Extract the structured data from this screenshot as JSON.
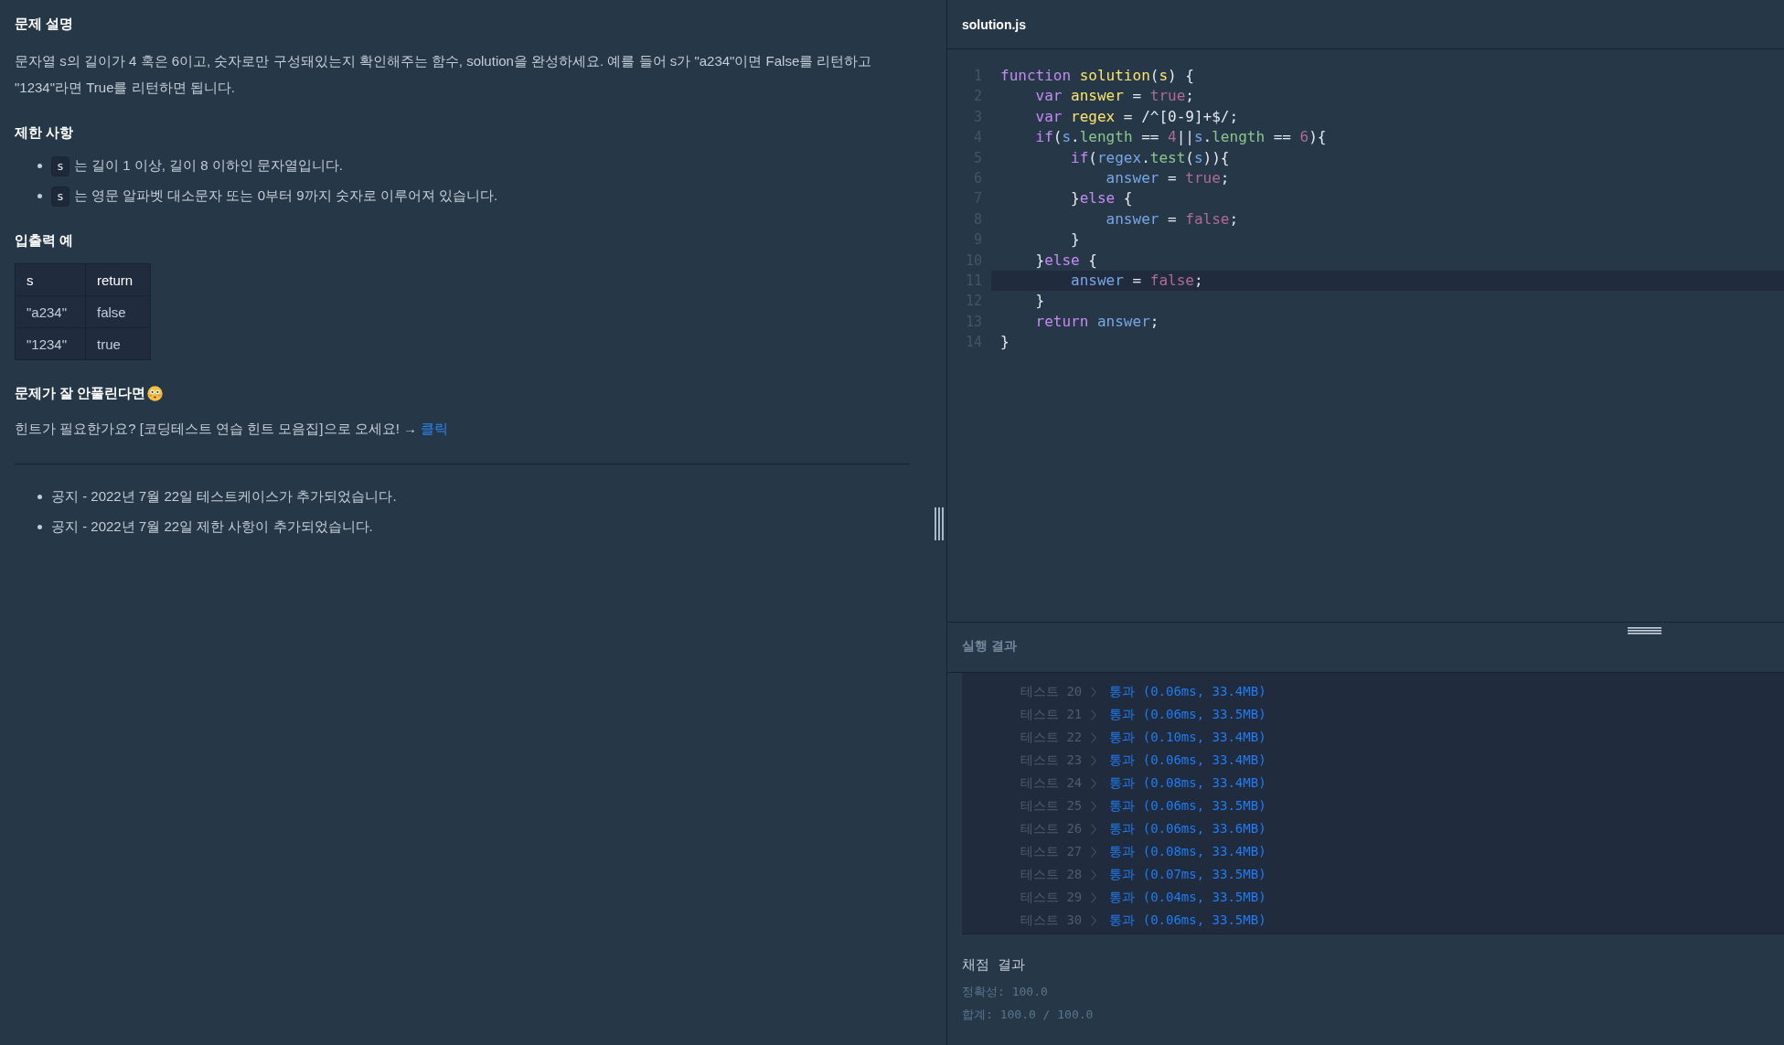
{
  "problem": {
    "title": "문제 설명",
    "description": "문자열 s의 길이가 4 혹은 6이고, 숫자로만 구성돼있는지 확인해주는 함수, solution을 완성하세요. 예를 들어 s가 \"a234\"이면 False를 리턴하고 \"1234\"라면 True를 리턴하면 됩니다.",
    "constraints_title": "제한 사항",
    "constraints": [
      {
        "code": "s",
        "text": "는 길이 1 이상, 길이 8 이하인 문자열입니다."
      },
      {
        "code": "s",
        "text": "는 영문 알파벳 대소문자 또는 0부터 9까지 숫자로 이루어져 있습니다."
      }
    ],
    "examples_title": "입출력 예",
    "examples": {
      "columns": [
        "s",
        "return"
      ],
      "rows": [
        [
          "\"a234\"",
          "false"
        ],
        [
          "\"1234\"",
          "true"
        ]
      ]
    },
    "hint_title": "문제가 잘 안풀린다면",
    "hint": {
      "text": "힌트가 필요한가요? [코딩테스트 연습 힌트 모음집]으로 오세요! →",
      "link": "클릭"
    },
    "notices": [
      "공지 - 2022년 7월 22일 테스트케이스가 추가되었습니다.",
      "공지 - 2022년 7월 22일 제한 사항이 추가되었습니다."
    ]
  },
  "editor": {
    "filename": "solution.js",
    "lines": [
      {
        "number": "1",
        "current": false,
        "tokens": [
          {
            "kind": "keyword",
            "text": "function "
          },
          {
            "kind": "definition",
            "text": "solution"
          },
          {
            "kind": "plain",
            "text": "("
          },
          {
            "kind": "definition",
            "text": "s"
          },
          {
            "kind": "plain",
            "text": ") {"
          }
        ]
      },
      {
        "number": "2",
        "current": false,
        "tokens": [
          {
            "kind": "keyword",
            "text": "    var "
          },
          {
            "kind": "definition",
            "text": "answer"
          },
          {
            "kind": "plain",
            "text": " = "
          },
          {
            "kind": "atom",
            "text": "true"
          },
          {
            "kind": "plain",
            "text": ";"
          }
        ]
      },
      {
        "number": "3",
        "current": false,
        "tokens": [
          {
            "kind": "keyword",
            "text": "    var "
          },
          {
            "kind": "definition",
            "text": "regex"
          },
          {
            "kind": "plain",
            "text": " = /^[0-9]+$/;"
          }
        ]
      },
      {
        "number": "4",
        "current": false,
        "tokens": [
          {
            "kind": "keyword",
            "text": "    if"
          },
          {
            "kind": "plain",
            "text": "("
          },
          {
            "kind": "variable",
            "text": "s"
          },
          {
            "kind": "plain",
            "text": "."
          },
          {
            "kind": "property",
            "text": "length"
          },
          {
            "kind": "plain",
            "text": " == "
          },
          {
            "kind": "atom",
            "text": "4"
          },
          {
            "kind": "plain",
            "text": "||"
          },
          {
            "kind": "variable",
            "text": "s"
          },
          {
            "kind": "plain",
            "text": "."
          },
          {
            "kind": "property",
            "text": "length"
          },
          {
            "kind": "plain",
            "text": " == "
          },
          {
            "kind": "atom",
            "text": "6"
          },
          {
            "kind": "plain",
            "text": "){"
          }
        ]
      },
      {
        "number": "5",
        "current": false,
        "tokens": [
          {
            "kind": "keyword",
            "text": "        if"
          },
          {
            "kind": "plain",
            "text": "("
          },
          {
            "kind": "variable",
            "text": "regex"
          },
          {
            "kind": "plain",
            "text": "."
          },
          {
            "kind": "property",
            "text": "test"
          },
          {
            "kind": "plain",
            "text": "("
          },
          {
            "kind": "variable",
            "text": "s"
          },
          {
            "kind": "plain",
            "text": ")){"
          }
        ]
      },
      {
        "number": "6",
        "current": false,
        "tokens": [
          {
            "kind": "variable",
            "text": "            answer"
          },
          {
            "kind": "plain",
            "text": " = "
          },
          {
            "kind": "atom",
            "text": "true"
          },
          {
            "kind": "plain",
            "text": ";"
          }
        ]
      },
      {
        "number": "7",
        "current": false,
        "tokens": [
          {
            "kind": "plain",
            "text": "        }"
          },
          {
            "kind": "keyword",
            "text": "else"
          },
          {
            "kind": "plain",
            "text": " {"
          }
        ]
      },
      {
        "number": "8",
        "current": false,
        "tokens": [
          {
            "kind": "variable",
            "text": "            answer"
          },
          {
            "kind": "plain",
            "text": " = "
          },
          {
            "kind": "atom",
            "text": "false"
          },
          {
            "kind": "plain",
            "text": ";"
          }
        ]
      },
      {
        "number": "9",
        "current": false,
        "tokens": [
          {
            "kind": "plain",
            "text": "        }"
          }
        ]
      },
      {
        "number": "10",
        "current": false,
        "tokens": [
          {
            "kind": "plain",
            "text": "    }"
          },
          {
            "kind": "keyword",
            "text": "else"
          },
          {
            "kind": "plain",
            "text": " {"
          }
        ]
      },
      {
        "number": "11",
        "current": true,
        "tokens": [
          {
            "kind": "variable",
            "text": "        answer"
          },
          {
            "kind": "plain",
            "text": " = "
          },
          {
            "kind": "atom",
            "text": "false"
          },
          {
            "kind": "plain",
            "text": ";"
          }
        ]
      },
      {
        "number": "12",
        "current": false,
        "tokens": [
          {
            "kind": "plain",
            "text": "    }"
          }
        ]
      },
      {
        "number": "13",
        "current": false,
        "tokens": [
          {
            "kind": "keyword",
            "text": "    return "
          },
          {
            "kind": "variable",
            "text": "answer"
          },
          {
            "kind": "plain",
            "text": ";"
          }
        ]
      },
      {
        "number": "14",
        "current": false,
        "tokens": [
          {
            "kind": "plain",
            "text": "}"
          }
        ]
      }
    ]
  },
  "results": {
    "title": "실행 결과",
    "tests": [
      {
        "label": "테스트 20",
        "outcome": "통과 (0.06ms, 33.4MB)"
      },
      {
        "label": "테스트 21",
        "outcome": "통과 (0.06ms, 33.5MB)"
      },
      {
        "label": "테스트 22",
        "outcome": "통과 (0.10ms, 33.4MB)"
      },
      {
        "label": "테스트 23",
        "outcome": "통과 (0.06ms, 33.4MB)"
      },
      {
        "label": "테스트 24",
        "outcome": "통과 (0.08ms, 33.4MB)"
      },
      {
        "label": "테스트 25",
        "outcome": "통과 (0.06ms, 33.5MB)"
      },
      {
        "label": "테스트 26",
        "outcome": "통과 (0.06ms, 33.6MB)"
      },
      {
        "label": "테스트 27",
        "outcome": "통과 (0.08ms, 33.4MB)"
      },
      {
        "label": "테스트 28",
        "outcome": "통과 (0.07ms, 33.5MB)"
      },
      {
        "label": "테스트 29",
        "outcome": "통과 (0.04ms, 33.5MB)"
      },
      {
        "label": "테스트 30",
        "outcome": "통과 (0.06ms, 33.5MB)"
      }
    ],
    "grading": {
      "title": "채점 결과",
      "lines": [
        "정확성: 100.0",
        "합계: 100.0 / 100.0"
      ]
    }
  }
}
